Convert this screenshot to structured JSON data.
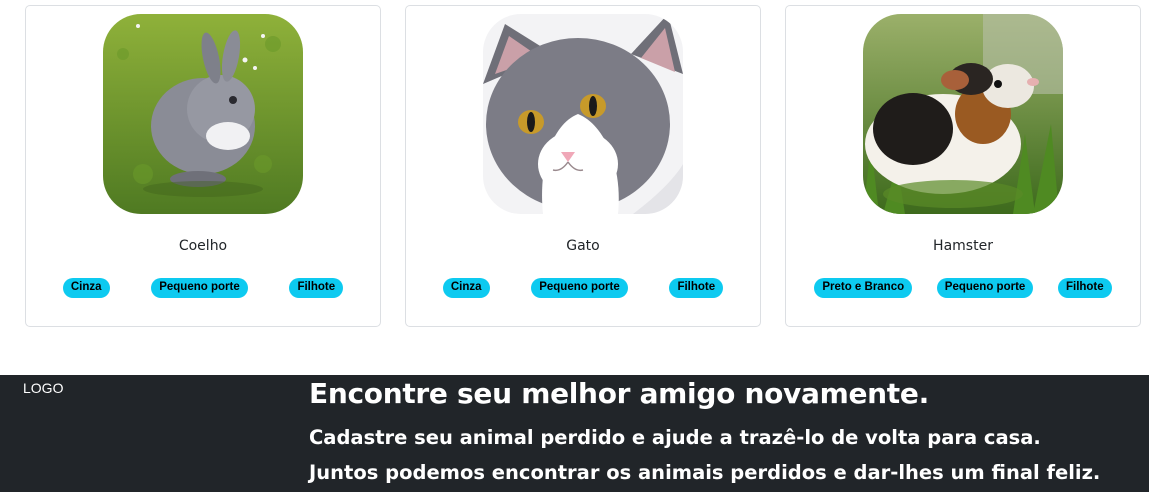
{
  "cards": [
    {
      "image": "rabbit-photo",
      "name": "Coelho",
      "badges": [
        "Cinza",
        "Pequeno porte",
        "Filhote"
      ]
    },
    {
      "image": "cat-photo",
      "name": "Gato",
      "badges": [
        "Cinza",
        "Pequeno porte",
        "Filhote"
      ]
    },
    {
      "image": "guinea-pig-photo",
      "name": "Hamster",
      "badges": [
        "Preto e Branco",
        "Pequeno porte",
        "Filhote"
      ]
    }
  ],
  "footer": {
    "logo": "LOGO",
    "title": "Encontre seu melhor amigo novamente.",
    "line1": "Cadastre seu animal perdido e ajude a trazê-lo de volta para casa.",
    "line2": "Juntos podemos encontrar os animais perdidos e dar-lhes um final feliz."
  },
  "colors": {
    "badge": "#0dcaf0",
    "footer_bg": "#212529",
    "card_border": "#dcdfe3"
  }
}
